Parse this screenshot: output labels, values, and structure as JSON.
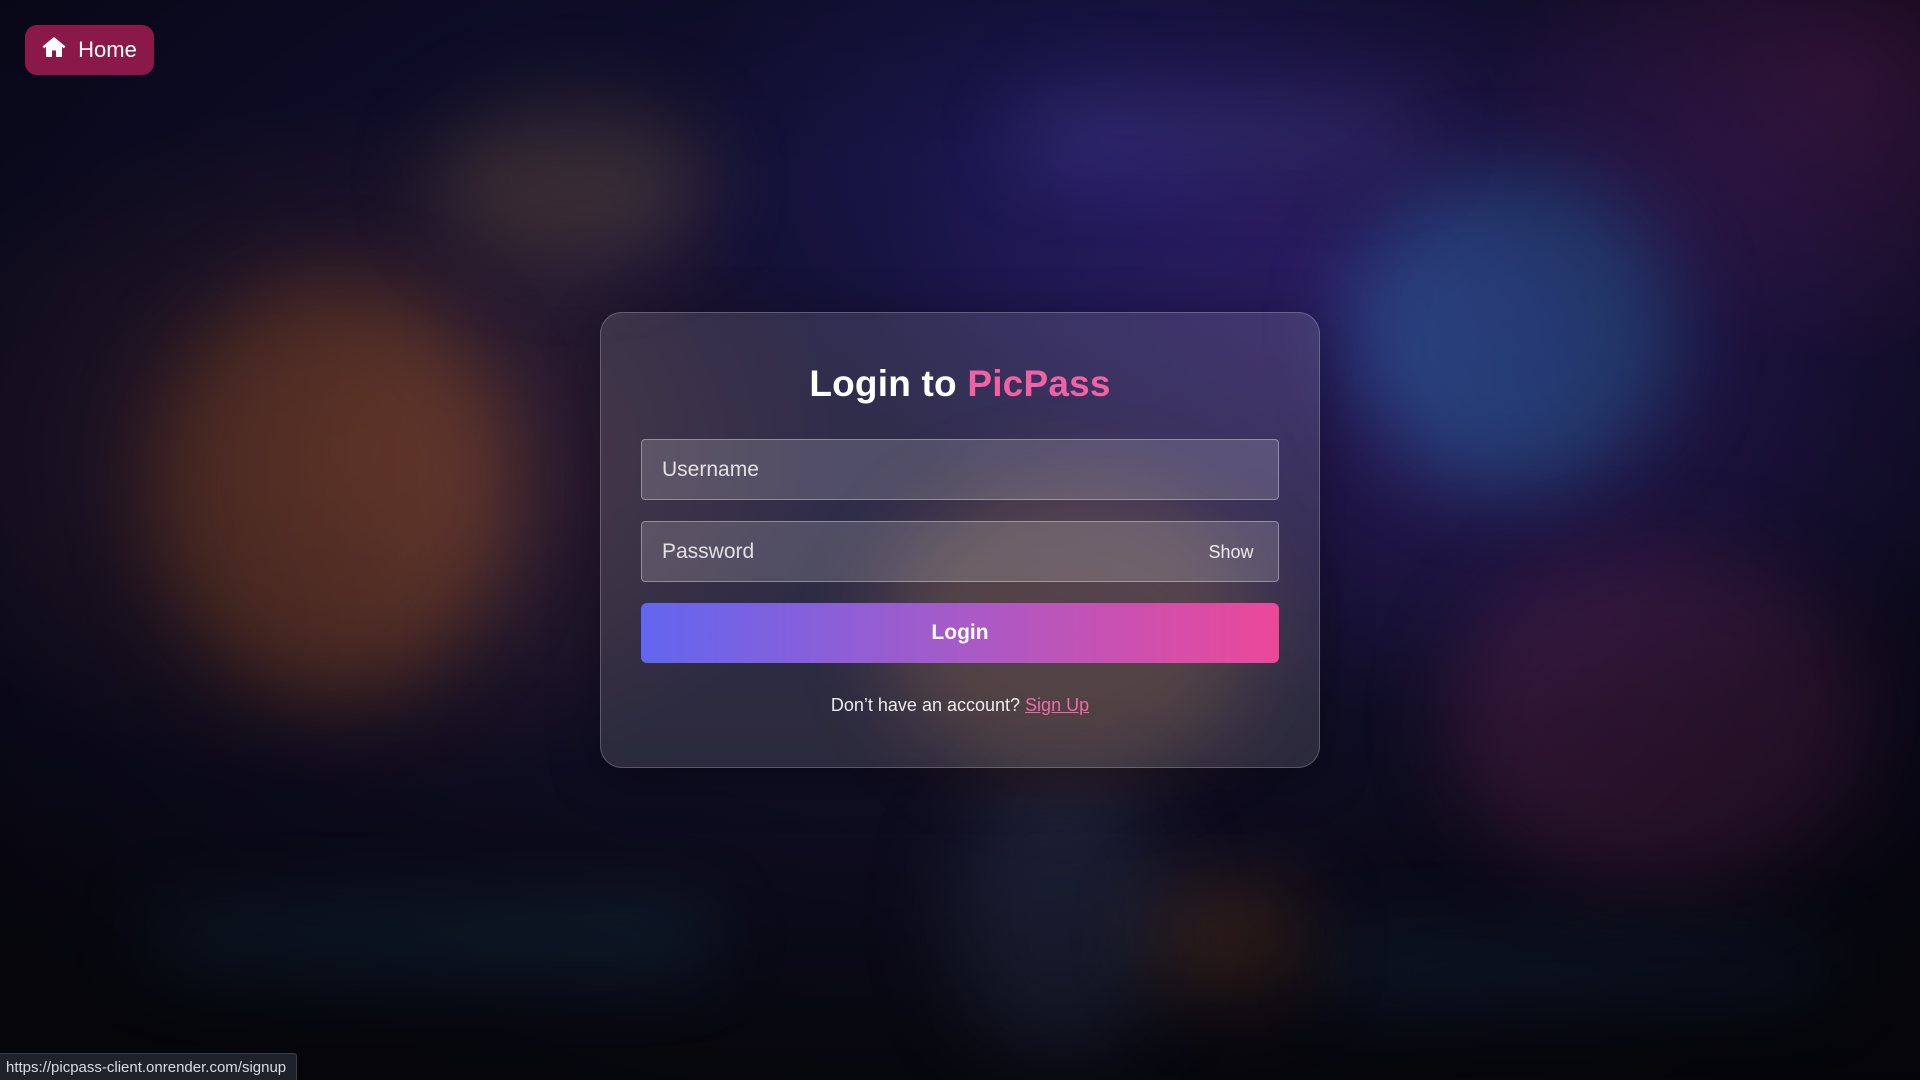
{
  "nav": {
    "home_label": "Home",
    "home_icon": "home-icon"
  },
  "login_card": {
    "title_prefix": "Login to",
    "title_brand": "PicPass",
    "username_placeholder": "Username",
    "username_value": "",
    "password_placeholder": "Password",
    "password_value": "",
    "show_label": "Show",
    "login_button_label": "Login",
    "signup_prompt": "Don’t have an account?",
    "signup_link_label": "Sign Up"
  },
  "status_bar": {
    "url": "https://picpass-client.onrender.com/signup"
  },
  "colors": {
    "home_button_bg": "#8a1849",
    "brand_accent": "#f062a4",
    "gradient_start": "#6266f0",
    "gradient_end": "#ec4899"
  }
}
